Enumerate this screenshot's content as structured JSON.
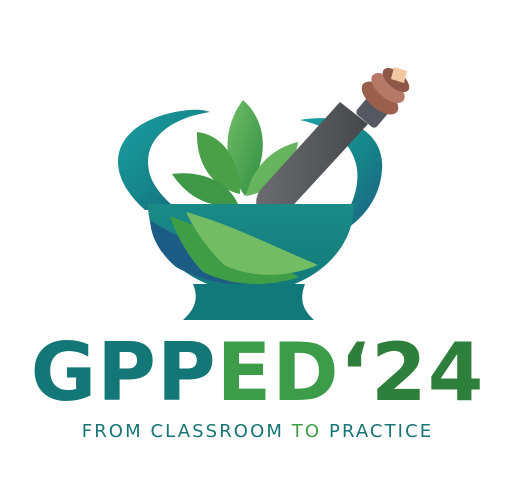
{
  "brand": {
    "title_parts": [
      {
        "text": "GPP",
        "color": "#147777"
      },
      {
        "text": "ED",
        "color": "#3c9c4a"
      },
      {
        "text": "‘24",
        "color": "#2f7f3c"
      }
    ],
    "tagline_parts": [
      {
        "text": "FROM CLASSROOM ",
        "color": "#167474"
      },
      {
        "text": "TO",
        "color": "#3f9e45"
      },
      {
        "text": " PRACTICE",
        "color": "#167474"
      }
    ]
  },
  "colors": {
    "teal": "#17858a",
    "deep_blue": "#1c5d86",
    "green": "#3f9e45",
    "light_green": "#71bd64",
    "pestle_gray": "#595b5e",
    "pestle_copper": "#9f6250"
  },
  "icons": {
    "logo": "mortar-and-pestle-with-leaves-icon"
  }
}
